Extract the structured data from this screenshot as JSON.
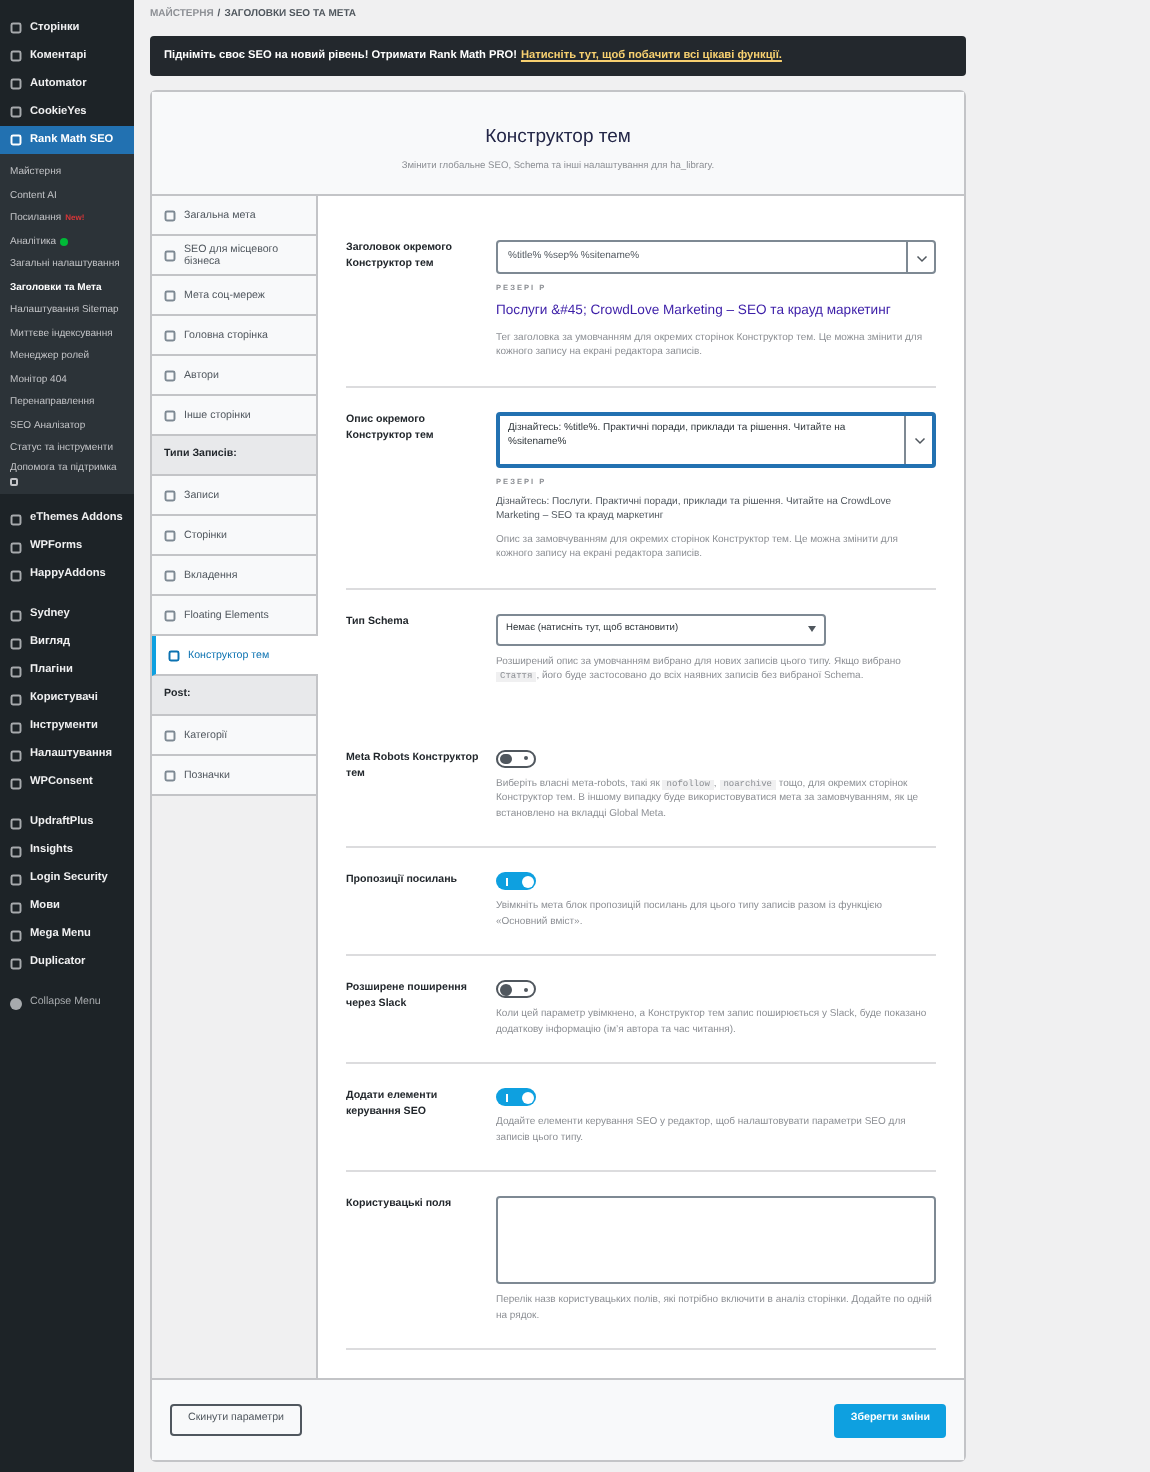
{
  "sidebar": {
    "sections": [
      {
        "items": [
          {
            "label": "Сторінки",
            "selected": false
          },
          {
            "label": "Коментарі",
            "selected": false
          },
          {
            "label": "Automator",
            "selected": false
          },
          {
            "label": "CookieYes",
            "selected": false
          },
          {
            "label": "Rank Math SEO",
            "selected": true,
            "submenu": [
              {
                "label": "Майстерня",
                "selected": false
              },
              {
                "label": "Content AI",
                "selected": false
              },
              {
                "label": "Посилання",
                "selected": false,
                "badge": "New!"
              },
              {
                "label": "Аналітика",
                "selected": false,
                "color": "#00ba37"
              },
              {
                "label": "Загальні налаштування",
                "selected": false
              },
              {
                "label": "Заголовки та Мета",
                "selected": true
              },
              {
                "label": "Налаштування Sitemap",
                "selected": false
              },
              {
                "label": "Миттєве індексування",
                "selected": false
              },
              {
                "label": "Менеджер ролей",
                "selected": false
              },
              {
                "label": "Монітор 404",
                "selected": false
              },
              {
                "label": "Перенаправлення",
                "selected": false
              },
              {
                "label": "SEO Аналізатор",
                "selected": false
              },
              {
                "label": "Статус та інструменти",
                "selected": false
              },
              {
                "label": "Допомога та підтримка",
                "selected": false,
                "external": true
              }
            ]
          }
        ]
      },
      {
        "items": [
          {
            "label": "eThemes Addons",
            "selected": false
          },
          {
            "label": "WPForms",
            "selected": false
          },
          {
            "label": "HappyAddons",
            "selected": false
          }
        ]
      },
      {
        "items": [
          {
            "label": "Sydney",
            "selected": false
          },
          {
            "label": "Вигляд",
            "selected": false
          },
          {
            "label": "Плагіни",
            "selected": false
          },
          {
            "label": "Користувачі",
            "selected": false
          },
          {
            "label": "Інструменти",
            "selected": false
          },
          {
            "label": "Налаштування",
            "selected": false
          },
          {
            "label": "WPConsent",
            "selected": false
          }
        ]
      },
      {
        "items": [
          {
            "label": "UpdraftPlus",
            "selected": false
          },
          {
            "label": "Insights",
            "selected": false
          },
          {
            "label": "Login Security",
            "selected": false
          },
          {
            "label": "Мови",
            "selected": false
          },
          {
            "label": "Mega Menu",
            "selected": false
          },
          {
            "label": "Duplicator",
            "selected": false
          }
        ]
      }
    ],
    "collapse": "Collapse Menu"
  },
  "breadcrumb": {
    "parent": "МАЙСТЕРНЯ",
    "separator": "/",
    "current": "ЗАГОЛОВКИ SEO ТА МЕТА"
  },
  "banner": {
    "text": "Підніміть своє SEO на новий рівень! Отримати Rank Math PRO!",
    "link": "Натисніть тут, щоб побачити всі цікаві функції."
  },
  "header": {
    "title": "Конструктор тем",
    "subtitle": "Змінити глобальне SEO, Schema та інші налаштування для ha_library."
  },
  "tabs": [
    {
      "kind": "tab",
      "label": "Загальна мета",
      "selected": false
    },
    {
      "kind": "tab",
      "label": "SEO для місцевого бізнеса",
      "selected": false
    },
    {
      "kind": "tab",
      "label": "Мета соц-мереж",
      "selected": false
    },
    {
      "kind": "tab",
      "label": "Головна сторінка",
      "selected": false
    },
    {
      "kind": "tab",
      "label": "Автори",
      "selected": false
    },
    {
      "kind": "tab",
      "label": "Інше сторінки",
      "selected": false
    },
    {
      "kind": "heading",
      "label": "Типи Записів:"
    },
    {
      "kind": "tab",
      "label": "Записи",
      "selected": false
    },
    {
      "kind": "tab",
      "label": "Сторінки",
      "selected": false
    },
    {
      "kind": "tab",
      "label": "Вкладення",
      "selected": false
    },
    {
      "kind": "tab",
      "label": "Floating Elements",
      "selected": false
    },
    {
      "kind": "tab",
      "label": "Конструктор тем",
      "selected": true
    },
    {
      "kind": "heading",
      "label": "Post:"
    },
    {
      "kind": "tab",
      "label": "Категорії",
      "selected": false
    },
    {
      "kind": "tab",
      "label": "Позначки",
      "selected": false
    }
  ],
  "settings": [
    {
      "kind": "text",
      "label": "Заголовок окремого Конструктор тем",
      "value": "%title% %sep% %sitename%",
      "preview_label": "PЕЗЕPI P",
      "preview": "Послуги &#45; CrowdLove Marketing – SEO та крауд маркетинг",
      "description": [
        {
          "kind": "text",
          "text": "Тег заголовка за умовчанням для окремих сторінок Конструктор тем. Це можна змінити для кожного запису на екрані редактора записів."
        }
      ]
    },
    {
      "kind": "textarea",
      "label": "Опис окремого Конструктор тем",
      "value": "Дізнайтесь: %title%. Практичні поради, приклади та рішення. Читайте на %sitename%",
      "focused": true,
      "preview_label": "PЕЗЕPI P",
      "preview_plain": "Дізнайтесь: Послуги. Практичні поради, приклади та рішення. Читайте на CrowdLove Marketing – SEO та крауд маркетинг",
      "description": [
        {
          "kind": "text",
          "text": "Опис за замовчуванням для окремих сторінок Конструктор тем. Це можна змінити для кожного запису на екрані редактора записів."
        }
      ]
    },
    {
      "kind": "select",
      "label": "Тип Schema",
      "value": "Немає (натисніть тут, щоб встановити)",
      "description": [
        {
          "kind": "text",
          "text": "Розширений опис за умовчанням вибрано для нових записів цього типу. Якщо вибрано "
        },
        {
          "kind": "code",
          "text": "Стаття"
        },
        {
          "kind": "text",
          "text": ", його буде застосовано до всіх наявних записів без вибраної Schema."
        }
      ]
    },
    {
      "kind": "toggle",
      "label": "Meta Robots Конструктор тем",
      "on": false,
      "description": [
        {
          "kind": "text",
          "text": "Виберіть власні мета-robots, такі як "
        },
        {
          "kind": "code",
          "text": "nofollow"
        },
        {
          "kind": "text",
          "text": ", "
        },
        {
          "kind": "code",
          "text": "noarchive"
        },
        {
          "kind": "text",
          "text": " тощо, для окремих сторінок Конструктор тем. В іншому випадку буде використовуватися мета за замовчуванням, як це встановлено на вкладці Global Meta."
        }
      ]
    },
    {
      "kind": "toggle",
      "label": "Пропозиції посилань",
      "on": true,
      "description": [
        {
          "kind": "text",
          "text": "Увімкніть мета блок пропозицій посилань для цього типу записів разом із функцією «Основний вміст»."
        }
      ]
    },
    {
      "kind": "toggle",
      "label": "Розширене поширення через Slack",
      "on": false,
      "description": [
        {
          "kind": "text",
          "text": "Коли цей параметр увімкнено, а Конструктор тем запис поширюється у Slack, буде показано додаткову інформацію (ім’я автора та час читання)."
        }
      ]
    },
    {
      "kind": "toggle",
      "label": "Додати елементи керування SEO",
      "on": true,
      "description": [
        {
          "kind": "text",
          "text": "Додайте елементи керування SEO у редактор, щоб налаштовувати параметри SEO для записів цього типу."
        }
      ]
    },
    {
      "kind": "textarea",
      "label": "Користувацькі поля",
      "focused": false,
      "description": [
        {
          "kind": "text",
          "text": "Перелік назв користувацьких полів, які потрібно включити в аналіз сторінки. Додайте по одній на рядок."
        }
      ]
    }
  ],
  "footer": {
    "reset": "Скинути параметри",
    "save": "Зберегти зміни"
  }
}
